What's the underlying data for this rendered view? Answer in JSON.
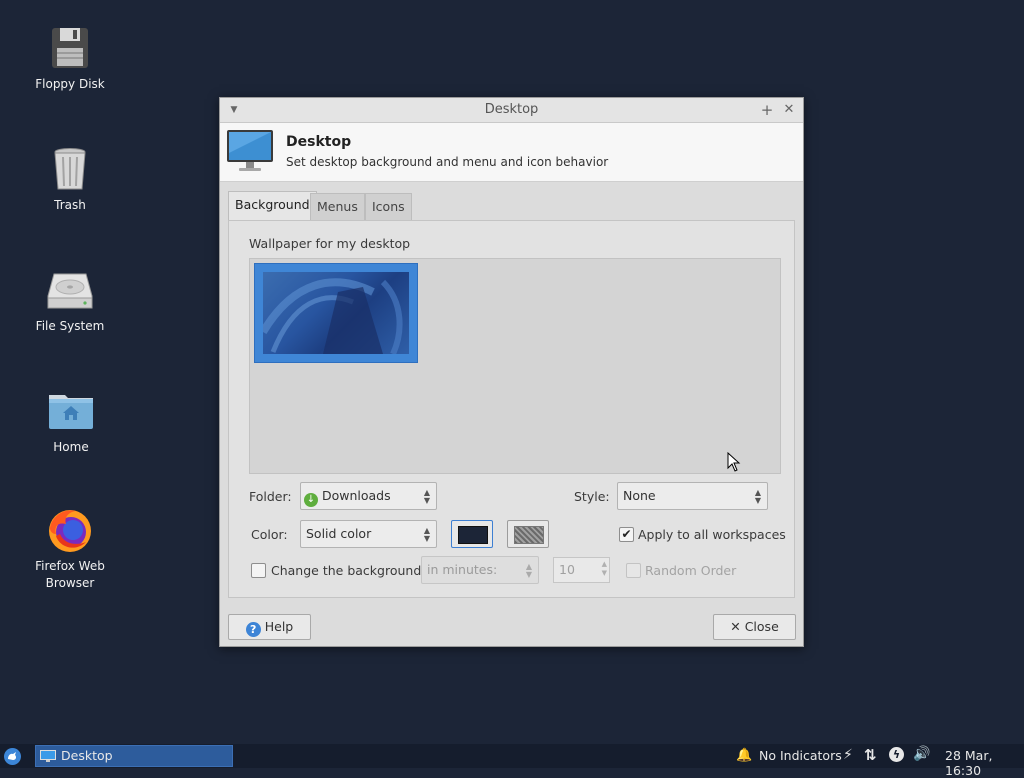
{
  "desktop": {
    "icons": [
      {
        "label": "Floppy Disk",
        "icon": "floppy-disk-icon"
      },
      {
        "label": "Trash",
        "icon": "trash-icon"
      },
      {
        "label": "File System",
        "icon": "hard-drive-icon"
      },
      {
        "label": "Home",
        "icon": "home-folder-icon"
      },
      {
        "label": "Firefox Web Browser",
        "icon": "firefox-icon"
      }
    ]
  },
  "window": {
    "title": "Desktop",
    "header_title": "Desktop",
    "header_subtitle": "Set desktop background and menu and icon behavior",
    "tabs": [
      {
        "label": "Background",
        "active": true
      },
      {
        "label": "Menus",
        "active": false
      },
      {
        "label": "Icons",
        "active": false
      }
    ],
    "background": {
      "wallpaper_label": "Wallpaper for my desktop",
      "folder_label": "Folder:",
      "folder_value": "Downloads",
      "style_label": "Style:",
      "style_value": "None",
      "color_label": "Color:",
      "color_value": "Solid color",
      "primary_color": "#1c2537",
      "apply_all_label": "Apply to all workspaces",
      "apply_all_checked": true,
      "change_bg_label": "Change the background",
      "change_bg_checked": false,
      "interval_value": "in minutes:",
      "minutes_value": "10",
      "random_order_label": "Random Order",
      "random_order_checked": false
    },
    "help_label": "Help",
    "close_label": "Close"
  },
  "taskbar": {
    "task_label": "Desktop",
    "indicators_label": "No Indicators",
    "clock": "28 Mar, 16:30"
  },
  "colors": {
    "desktop_bg": "#1c2537",
    "selection": "#3f86d6",
    "taskbar_task": "#2d5c9c"
  }
}
